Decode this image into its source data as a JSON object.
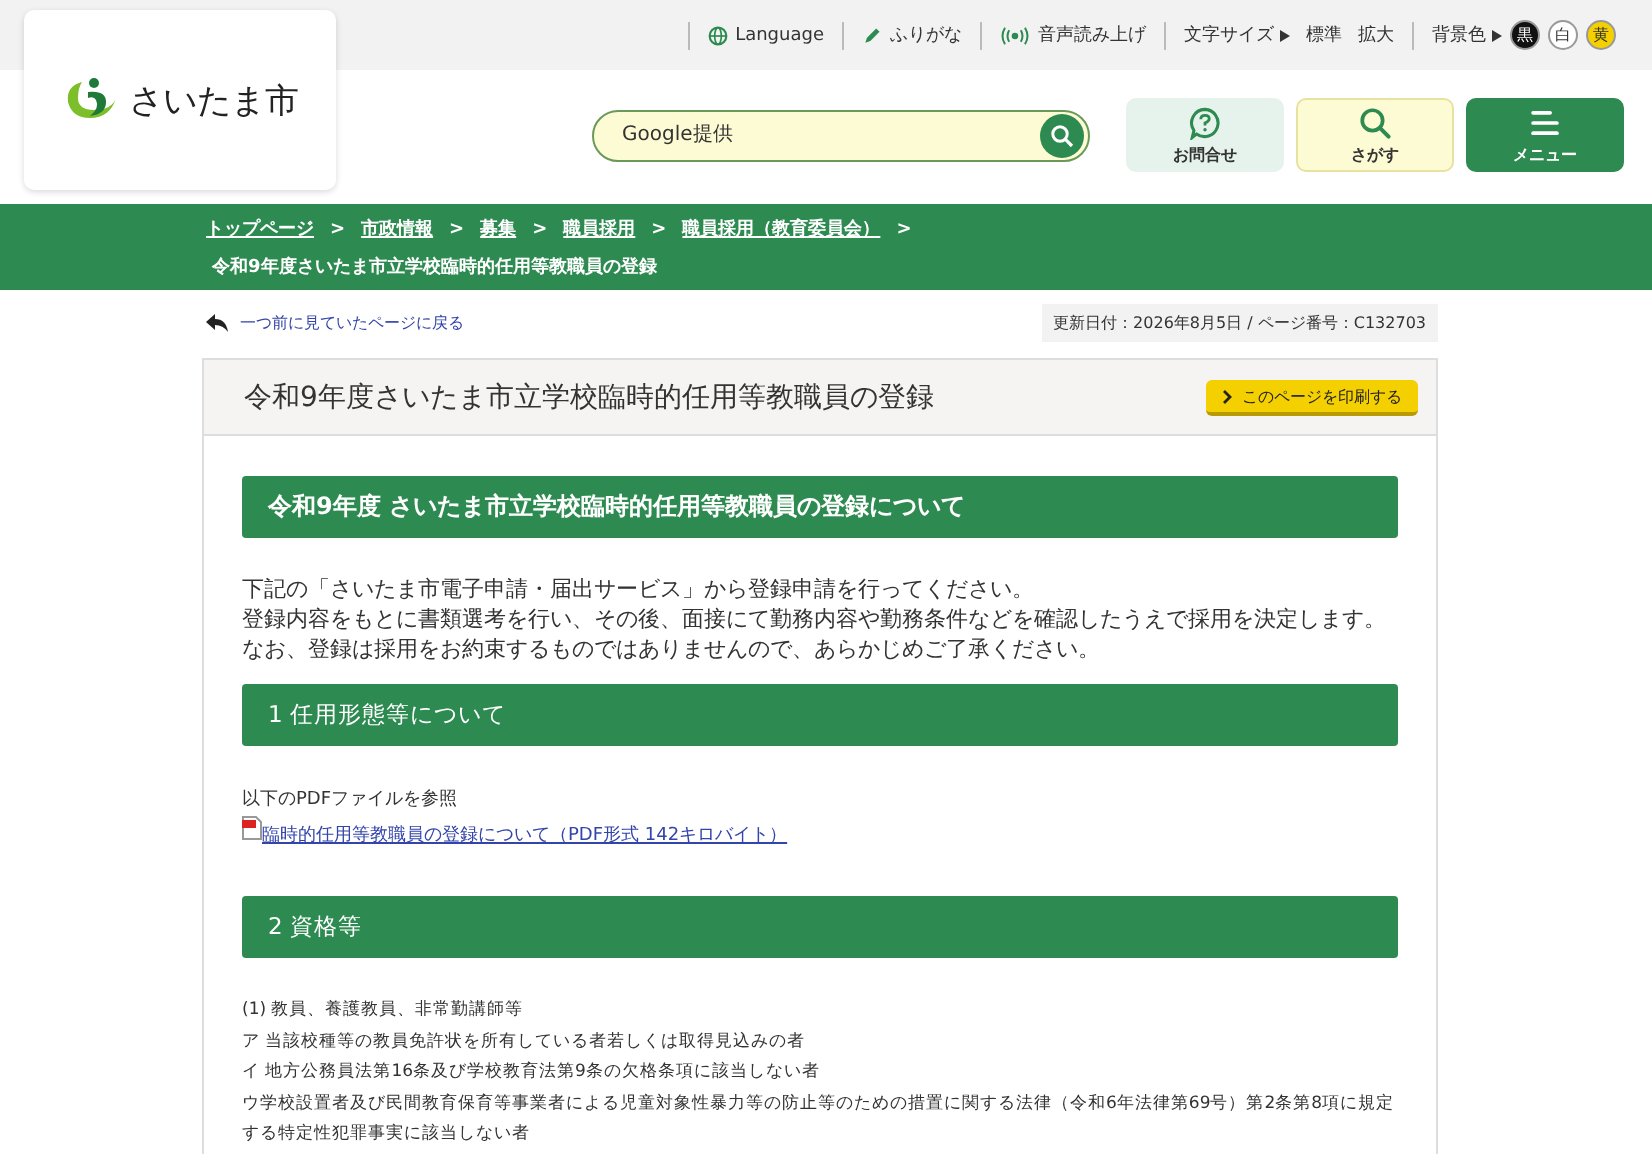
{
  "utility_bar": {
    "items": [
      {
        "kind": "globe",
        "label": "Language"
      },
      {
        "kind": "pencil",
        "label": "ふりがな"
      },
      {
        "kind": "speaker",
        "label": "音声読み上げ"
      }
    ],
    "font_size": {
      "label": "文字サイズ",
      "options": [
        "標準",
        "拡大"
      ]
    },
    "background_color": {
      "label": "背景色",
      "options": [
        {
          "label": "黒",
          "color": "#111111"
        },
        {
          "label": "白",
          "color": "#ffffff"
        },
        {
          "label": "黄",
          "color": "#f5d000"
        }
      ]
    }
  },
  "logo": {
    "text": "さいたま市"
  },
  "search": {
    "placeholder": "Google提供"
  },
  "header_buttons": [
    {
      "kind": "help",
      "label": "お問合せ"
    },
    {
      "kind": "search",
      "label": "さがす"
    },
    {
      "kind": "menu",
      "label": "メニュー"
    }
  ],
  "breadcrumb": {
    "separator": ">",
    "links": [
      "トップページ",
      "市政情報",
      "募集",
      "職員採用",
      "職員採用（教育委員会）"
    ],
    "current": "令和9年度さいたま市立学校臨時的任用等教職員の登録"
  },
  "back_link": "一つ前に見ていたページに戻る",
  "update_info": "更新日付：2026年8月5日 / ページ番号：C132703",
  "page": {
    "title": "令和9年度さいたま市立学校臨時的任用等教職員の登録",
    "print_button": "このページを印刷する",
    "heading": "令和9年度 さいたま市立学校臨時的任用等教職員の登録について",
    "intro": [
      "下記の「さいたま市電子申請・届出サービス」から登録申請を行ってください。",
      "登録内容をもとに書類選考を行い、その後、面接にて勤務内容や勤務条件などを確認したうえで採用を決定します。",
      "なお、登録は採用をお約束するものではありませんので、あらかじめご了承ください。"
    ],
    "sections": [
      {
        "heading": "1 任用形態等について",
        "body": [
          {
            "kind": "text",
            "text": "以下のPDFファイルを参照"
          },
          {
            "kind": "pdf_link",
            "text": "臨時的任用等教職員の登録について（PDF形式 142キロバイト）"
          }
        ]
      },
      {
        "heading": "2 資格等",
        "body": [
          {
            "kind": "text",
            "text": "(1) 教員、養護教員、非常勤講師等"
          },
          {
            "kind": "text",
            "text": "ア 当該校種等の教員免許状を所有している者若しくは取得見込みの者"
          },
          {
            "kind": "text",
            "text": "イ 地方公務員法第16条及び学校教育法第9条の欠格条項に該当しない者"
          },
          {
            "kind": "text",
            "text": "ウ学校設置者及び民間教育保育等事業者による児童対象性暴力等の防止等のための措置に関する法律（令和6年法律第69号）第2条第8項に規定する特定性犯罪事実に該当しない者"
          }
        ]
      }
    ]
  }
}
